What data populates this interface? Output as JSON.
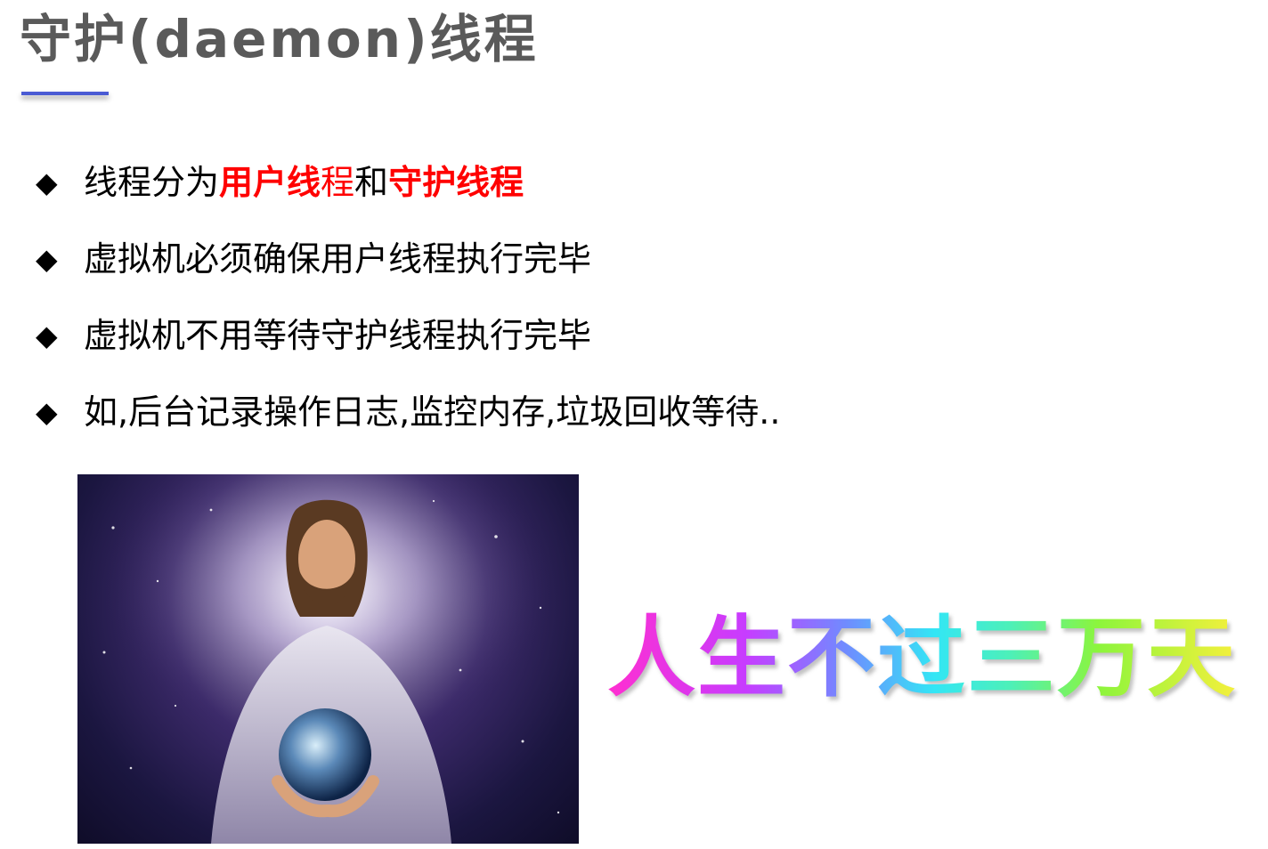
{
  "title": "守护(daemon)线程",
  "bullets": [
    {
      "icon": "diamond-bullet-icon",
      "prefix": "线程分为",
      "highlight1_bold": "用户线",
      "highlight1_plain": "程",
      "middle": "和",
      "highlight2": "守护线程"
    },
    {
      "icon": "diamond-bullet-icon",
      "text": "虚拟机必须确保用户线程执行完毕"
    },
    {
      "icon": "diamond-bullet-icon",
      "text": "虚拟机不用等待守护线程执行完毕"
    },
    {
      "icon": "diamond-bullet-icon",
      "text": "如,后台记录操作日志,监控内存,垃圾回收等待.."
    }
  ],
  "bullet_glyph": "◆",
  "slogan": "人生不过三万天",
  "colors": {
    "title": "#5a5a5a",
    "accent_underline": "#4a5bd4",
    "highlight": "#ff0000"
  }
}
